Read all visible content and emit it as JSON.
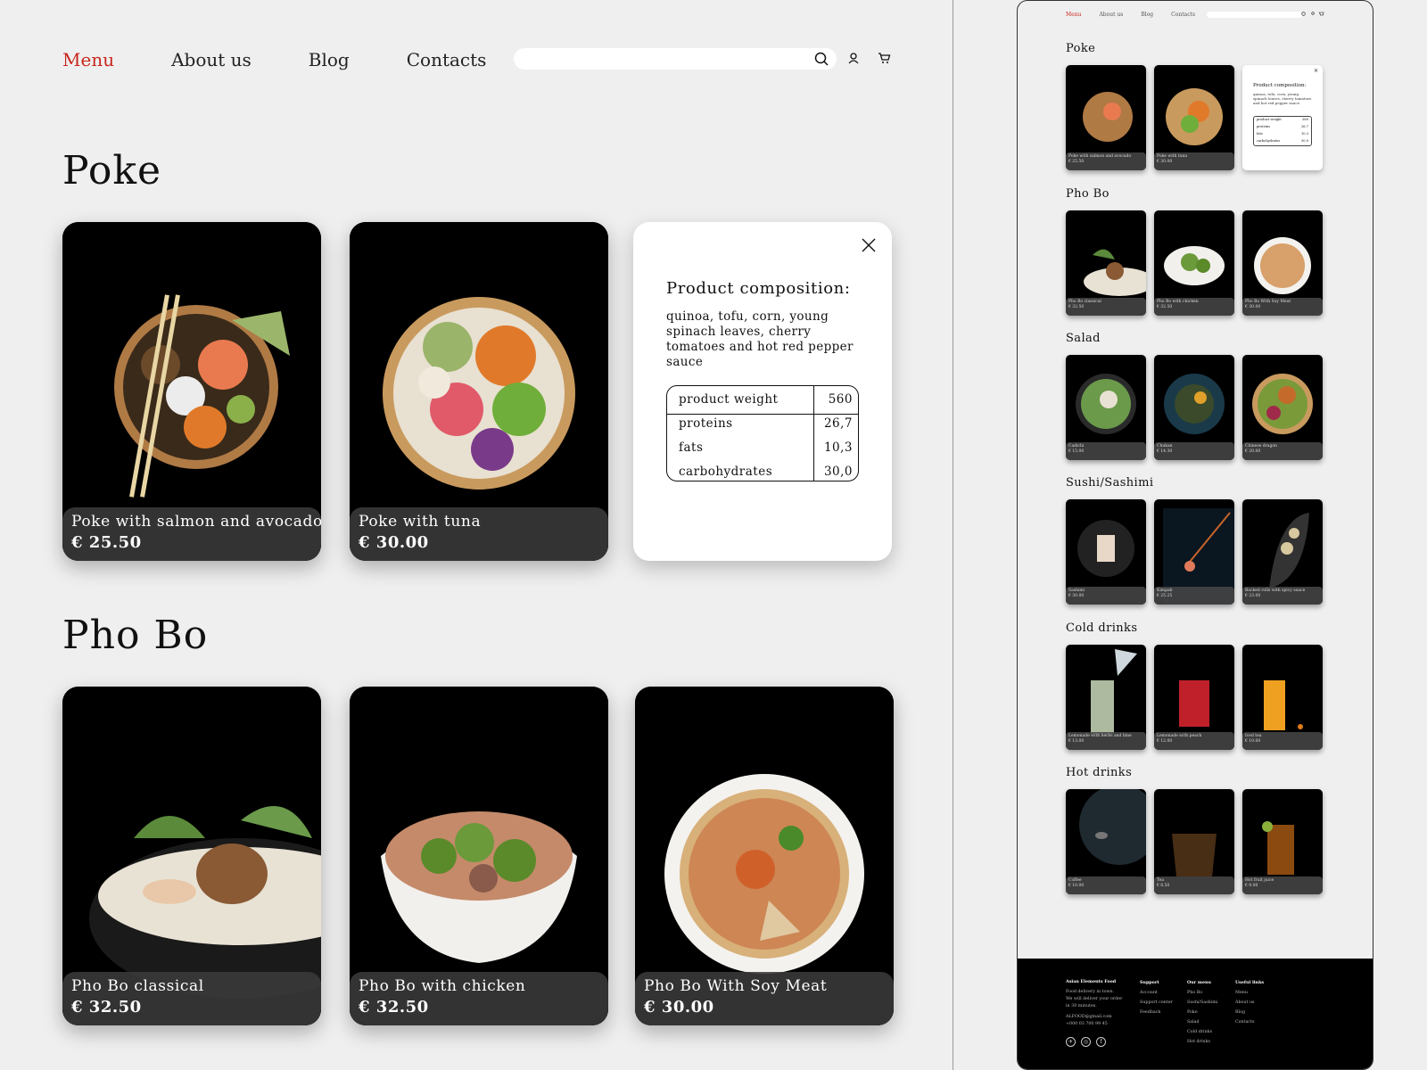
{
  "nav": {
    "items": [
      "Menu",
      "About us",
      "Blog",
      "Contacts"
    ],
    "active": "Menu"
  },
  "search": {
    "placeholder": ""
  },
  "sections": {
    "poke": "Poke",
    "pho_bo": "Pho Bo"
  },
  "poke_cards": [
    {
      "name": "Poke with salmon and avocado",
      "price": "€ 25.50"
    },
    {
      "name": "Poke with tuna",
      "price": "€ 30.00"
    }
  ],
  "pho_cards": [
    {
      "name": "Pho Bo classical",
      "price": "€ 32.50"
    },
    {
      "name": "Pho Bo with chicken",
      "price": "€ 32.50"
    },
    {
      "name": "Pho Bo With Soy Meat",
      "price": "€ 30.00"
    }
  ],
  "popup": {
    "title": "Product composition:",
    "description": "quinoa, tofu, corn, young spinach leaves, cherry tomatoes and hot red pepper sauce",
    "rows": [
      {
        "label": "product weight",
        "value": "560"
      },
      {
        "label": "proteins",
        "value": "26,7"
      },
      {
        "label": "fats",
        "value": "10,3"
      },
      {
        "label": "carbohydrates",
        "value": "30,0"
      }
    ]
  },
  "mini": {
    "nav": [
      "Menu",
      "About us",
      "Blog",
      "Contacts"
    ],
    "sections": [
      "Poke",
      "Pho Bo",
      "Salad",
      "Sushi/Sashimi",
      "Cold drinks",
      "Hot drinks"
    ],
    "cards": {
      "poke": [
        {
          "name": "Poke with salmon and avocado",
          "price": "€ 25.50"
        },
        {
          "name": "Poke with tuna",
          "price": "€ 30.00"
        }
      ],
      "pho": [
        {
          "name": "Pho Bo classical",
          "price": "€ 32.50"
        },
        {
          "name": "Pho Bo with chicken",
          "price": "€ 32.50"
        },
        {
          "name": "Pho Bo With Soy Meat",
          "price": "€ 30.00"
        }
      ],
      "salad": [
        {
          "name": "Cadichi",
          "price": "€ 15.00"
        },
        {
          "name": "Chukan",
          "price": "€ 14.30"
        },
        {
          "name": "Chinese dragon",
          "price": "€ 20.00"
        }
      ],
      "sushi": [
        {
          "name": "Sashimi",
          "price": "€ 30.00"
        },
        {
          "name": "Kimpab",
          "price": "€ 25.25"
        },
        {
          "name": "Backed rolls with spicy sauce",
          "price": "€ 23.00"
        }
      ],
      "cold": [
        {
          "name": "Lemonade with herbs and lime",
          "price": "€ 13.00"
        },
        {
          "name": "Lemonade with peach",
          "price": "€ 12.00"
        },
        {
          "name": "Iced tea",
          "price": "€ 10.00"
        }
      ],
      "hot": [
        {
          "name": "Coffee",
          "price": "€ 10.00"
        },
        {
          "name": "Tea",
          "price": "€ 8.50"
        },
        {
          "name": "Hot fruit juice",
          "price": "€ 9.00"
        }
      ]
    },
    "popup_title": "Product composition:",
    "popup_desc": "quinoa, tofu, corn, young spinach leaves, cherry tomatoes and hot red pepper sauce",
    "popup_rows": [
      {
        "label": "product weight",
        "value": "560"
      },
      {
        "label": "proteins",
        "value": "26,7"
      },
      {
        "label": "fats",
        "value": "10,3"
      },
      {
        "label": "carbohydrates",
        "value": "30,0"
      }
    ],
    "footer": {
      "brand": "Asian Elements Food",
      "tagline_1": "Food delivery in town.",
      "tagline_2": "We will deliver your order",
      "tagline_3": "in 30 minutes.",
      "email": "ALFOOD@gmail.com",
      "phone": "+000 03 700 99 45",
      "support": [
        "Support",
        "Account",
        "Support center",
        "Feedback"
      ],
      "menu": [
        "Our menu",
        "Pho Bo",
        "Sushi/Sashimi",
        "Poke",
        "Salad",
        "Cold drinks",
        "Hot drinks"
      ],
      "links": [
        "Useful links",
        "Menu",
        "About us",
        "Blog",
        "Contacts"
      ]
    }
  },
  "colors": {
    "accent": "#c8261c",
    "background": "#efefef",
    "card": "#000000",
    "caption": "#3a3a3a"
  }
}
